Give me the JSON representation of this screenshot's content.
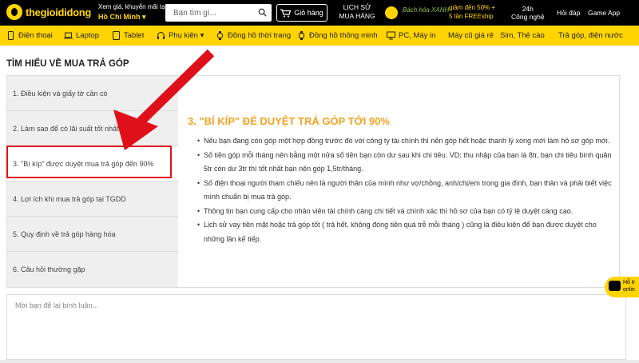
{
  "header": {
    "logo": "thegioididong",
    "location_line1": "Xem giá, khuyến mãi tại",
    "location_line2": "Hồ Chí Minh ▾",
    "search_placeholder": "Bạn tìm gì...",
    "cart_label": "Giỏ hàng",
    "history_line1": "LỊCH SỬ",
    "history_line2": "MUA HÀNG",
    "promo_brand": "Bách hóa XANH",
    "promo_line1": "giảm đến 50% +",
    "promo_line2": "5 lần FREEship",
    "nav_24h_line1": "24h",
    "nav_24h_line2": "Công nghệ",
    "nav_qa": "Hỏi đáp",
    "nav_gameapp": "Game App"
  },
  "menu": {
    "items": [
      {
        "label": "Điện thoại",
        "icon": "phone-icon"
      },
      {
        "label": "Laptop",
        "icon": "laptop-icon"
      },
      {
        "label": "Tablet",
        "icon": "tablet-icon"
      },
      {
        "label": "Phụ kiện ▾",
        "icon": "headphone-icon"
      },
      {
        "label": "Đồng hồ thời trang",
        "icon": "watch-icon"
      },
      {
        "label": "Đồng hồ thông minh",
        "icon": "smartwatch-icon"
      },
      {
        "label": "PC, Máy in",
        "icon": "pc-icon"
      },
      {
        "label": "Máy cũ giá rẻ",
        "icon": ""
      },
      {
        "label": "Sim, Thẻ cào",
        "icon": ""
      },
      {
        "label": "Trả góp, điện nước",
        "icon": ""
      }
    ]
  },
  "page": {
    "title": "TÌM HIỂU VỀ MUA TRẢ GÓP",
    "toc": [
      "1. Điều kiện và giấy tờ cần có",
      "2. Làm sao để có lãi suất tốt nhất",
      "3. \"Bí kíp\" được duyệt mua trả góp đến 90%",
      "4. Lợi ích khi mua trả góp tại TGDD",
      "5. Quy định về trả góp hàng hóa",
      "6. Câu hỏi thường gặp"
    ],
    "active_index": 2,
    "content_title": "3. \"BÍ KÍP\" ĐỂ DUYỆT TRẢ GÓP TỚI 90%",
    "bullets": [
      "Nếu bạn đang còn góp một hợp đồng trước đó với công ty tài chính thì nên góp hết hoặc thanh lý xong mới làm hồ sơ góp mới.",
      "Số tiền góp mỗi tháng nên bằng một nửa số tiền bạn còn dư sau khi chi tiêu. VD: thu nhập của bạn là 8tr, bạn chi tiêu bình quân 5tr còn dư 3tr thì tốt nhất bạn nên góp 1,5tr/tháng.",
      "Số điện thoại người tham chiếu nên là người thân của mình như vợ/chồng, anh/chị/em trong gia đình, bạn thân và phải biết việc mình chuẩn bị mua trả góp.",
      "Thông tin bạn cung cấp cho nhân viên tài chính càng chi tiết và chính xác thì hồ sơ của bạn có tỷ lệ duyệt càng cao.",
      "Lịch sử vay tiền mặt hoặc trả góp tốt ( trả hết, không đóng tiền quá trễ mỗi tháng ) cũng là điều kiện để bạn được duyệt cho những lần kế tiếp."
    ],
    "comment_placeholder": "Mời bạn để lại bình luận...",
    "chat_line1": "Hỗ tr",
    "chat_line2": "onlin"
  },
  "colors": {
    "brand_yellow": "#ffd400",
    "heading_orange": "#f2a324",
    "annotation_red": "#e0101b"
  }
}
